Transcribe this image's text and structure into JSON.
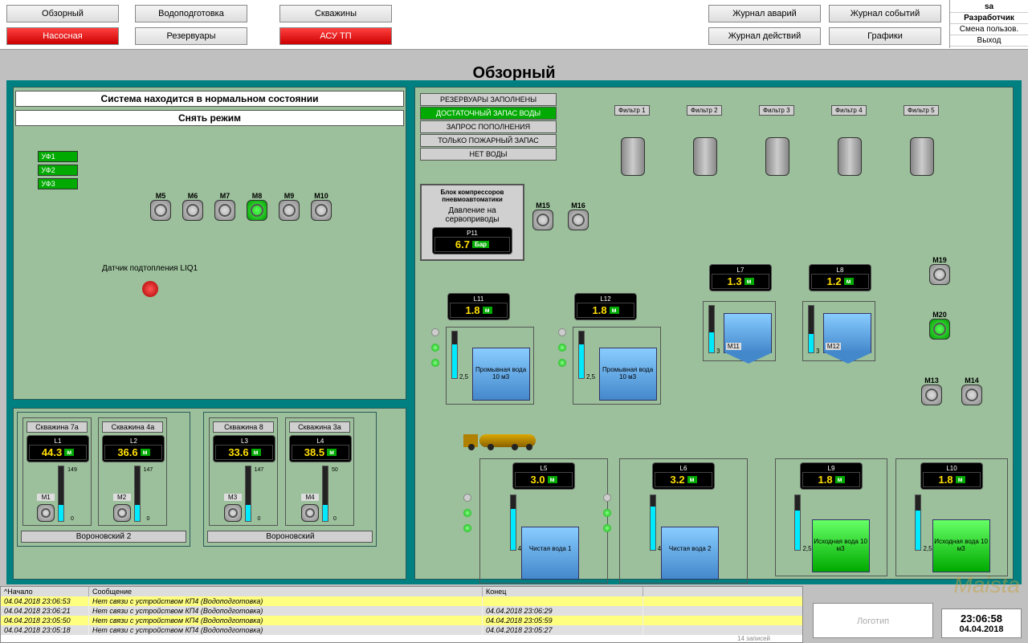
{
  "nav": {
    "obz": "Обзорный",
    "vodo": "Водоподготовка",
    "skv": "Скважины",
    "nasos": "Насосная",
    "rez": "Резервуары",
    "asu": "АСУ ТП",
    "alarm": "Журнал аварий",
    "event": "Журнал событий",
    "act": "Журнал действий",
    "graf": "Графики"
  },
  "user": {
    "name": "sa",
    "role": "Разработчик",
    "chg": "Смена пользов.",
    "exit": "Выход"
  },
  "title": "Обзорный",
  "status_normal": "Система находится в нормальном  состоянии",
  "mode_off": "Снять режим",
  "uv": [
    "УФ1",
    "УФ2",
    "УФ3"
  ],
  "sensor_lbl": "Датчик подтопления LIQ1",
  "pumps": [
    "М5",
    "М6",
    "М7",
    "М8",
    "М9",
    "М10"
  ],
  "wells": [
    {
      "name": "Скважина 7а",
      "l": "L1",
      "v": "44.3",
      "u": "м",
      "max": "149",
      "min": "0",
      "m": "M1"
    },
    {
      "name": "Скважина 4а",
      "l": "L2",
      "v": "36.6",
      "u": "м",
      "max": "147",
      "min": "0",
      "m": "M2"
    },
    {
      "name": "Скважина 8",
      "l": "L3",
      "v": "33.6",
      "u": "м",
      "max": "147",
      "min": "0",
      "m": "M3"
    },
    {
      "name": "Скважина 3а",
      "l": "L4",
      "v": "38.5",
      "u": "м",
      "max": "50",
      "min": "0",
      "m": "M4"
    }
  ],
  "well_grp1": "Вороновский 2",
  "well_grp2": "Вороновский",
  "statuses": [
    "РЕЗЕРВУАРЫ ЗАПОЛНЕНЫ",
    "ДОСТАТОЧНЫЙ ЗАПАС ВОДЫ",
    "ЗАПРОС ПОПОЛНЕНИЯ",
    "ТОЛЬКО ПОЖАРНЫЙ ЗАПАС",
    "НЕТ ВОДЫ"
  ],
  "status_active": 1,
  "comp": {
    "t1": "Блок компрессоров пневмоавтоматики",
    "t2": "Давление на сервоприводы",
    "p": "P11",
    "v": "6.7",
    "u": "Бар"
  },
  "filters": [
    "Фильтр 1",
    "Фильтр 2",
    "Фильтр 3",
    "Фильтр 4",
    "Фильтр 5"
  ],
  "m15": "М15",
  "m16": "М16",
  "m19": "M19",
  "m20": "M20",
  "m13": "M13",
  "m14": "M14",
  "l11": {
    "l": "L11",
    "v": "1.8",
    "u": "м"
  },
  "l12": {
    "l": "L12",
    "v": "1.8",
    "u": "м"
  },
  "l7": {
    "l": "L7",
    "v": "1.3",
    "u": "м"
  },
  "l8": {
    "l": "L8",
    "v": "1.2",
    "u": "м"
  },
  "l5": {
    "l": "L5",
    "v": "3.0",
    "u": "м"
  },
  "l6": {
    "l": "L6",
    "v": "3.2",
    "u": "м"
  },
  "l9": {
    "l": "L9",
    "v": "1.8",
    "u": "м"
  },
  "l10": {
    "l": "L10",
    "v": "1.8",
    "u": "м"
  },
  "tank_wash": "Промывная вода 10 м3",
  "tank_clean1": "Чистая вода 1",
  "tank_clean2": "Чистая вода 2",
  "tank_src": "Исходная вода 10 м3",
  "m11": "M11",
  "m12": "M12",
  "tick25": "2,5",
  "tick0": "0",
  "tick3": "3",
  "tick4": "4",
  "alarms": {
    "hdr": [
      "^Начало",
      "Сообщение",
      "Конец"
    ],
    "rows": [
      {
        "t": "04.04.2018 23:06:53",
        "m": "Нет связи с устройством КП4 (Водоподготовка)",
        "e": ""
      },
      {
        "t": "04.04.2018 23:06:21",
        "m": "Нет связи с устройством КП4 (Водоподготовка)",
        "e": "04.04.2018 23:06:29"
      },
      {
        "t": "04.04.2018 23:05:50",
        "m": "Нет связи с устройством КП4 (Водоподготовка)",
        "e": "04.04.2018 23:05:59"
      },
      {
        "t": "04.04.2018 23:05:18",
        "m": "Нет связи с устройством КП4 (Водоподготовка)",
        "e": "04.04.2018 23:05:27"
      }
    ],
    "count": "14  записей"
  },
  "clock": {
    "time": "23:06:58",
    "date": "04.04.2018"
  },
  "logo": "Логотип",
  "wm": "Maista"
}
